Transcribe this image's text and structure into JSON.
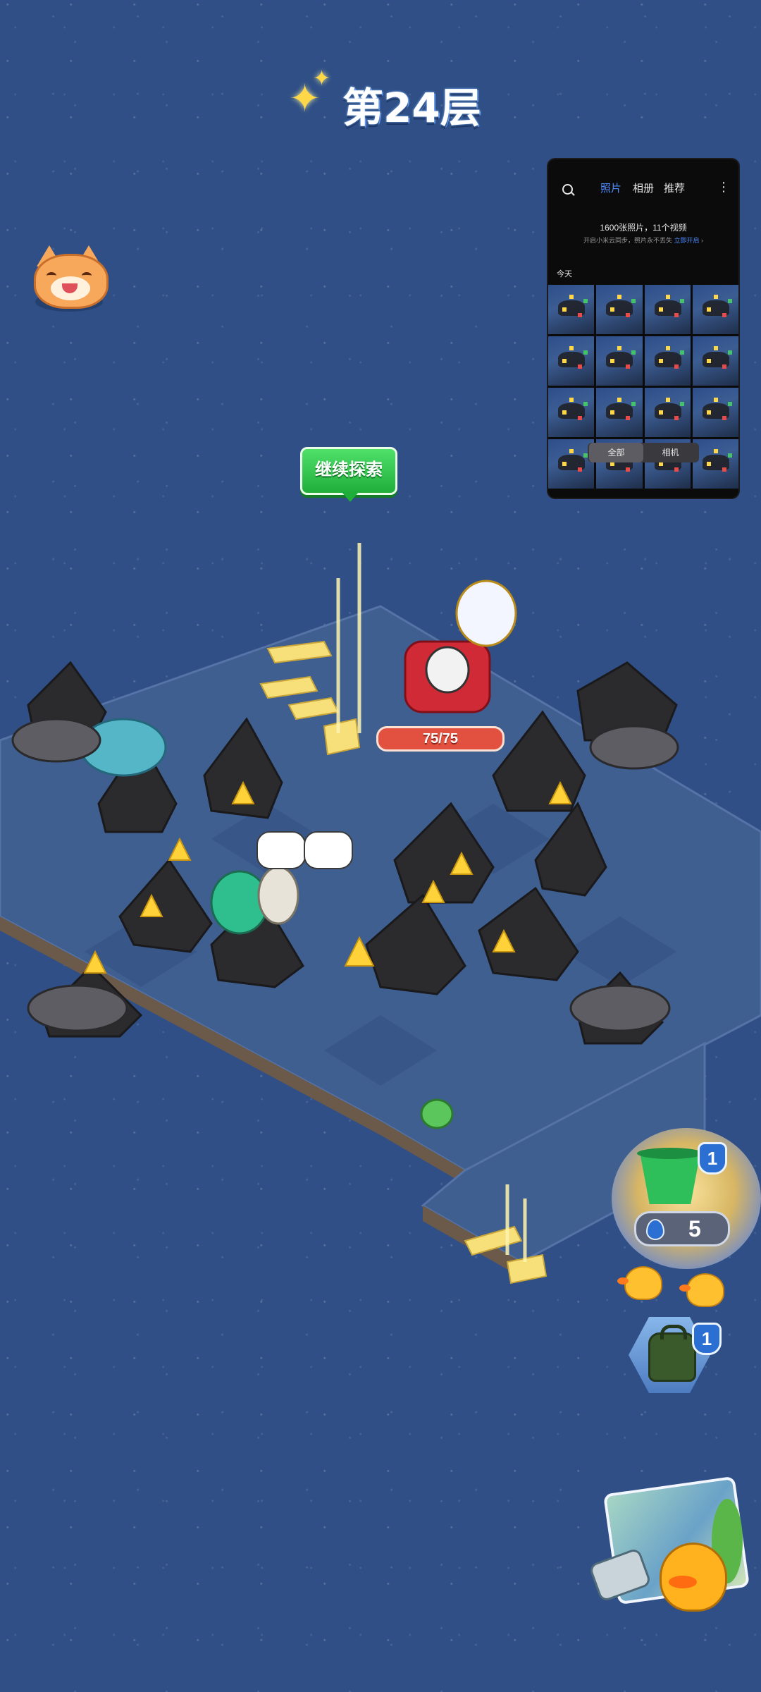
{
  "floor": {
    "title": "第24层"
  },
  "gallery": {
    "tabs": [
      "照片",
      "相册",
      "推荐"
    ],
    "active_tab": "照片",
    "summary": "1600张照片，11个视频",
    "notice": "开启小米云同步，照片永不丢失",
    "notice_link": "立即开启",
    "section": "今天",
    "segments": [
      "全部",
      "相机"
    ]
  },
  "board": {
    "continue_label": "继续探索",
    "boss_hp": "75/75"
  },
  "resources": {
    "bucket_badge": "1",
    "water_count": "5",
    "bag_badge": "1"
  },
  "colors": {
    "background": "#2f4f86",
    "tile": "#3f5f90",
    "button_green": "#2ec24a",
    "hp_red": "#e2503f"
  },
  "icons": [
    "sparkle-icon",
    "cat-avatar-icon",
    "search-icon",
    "more-icon",
    "bucket-icon",
    "water-drop-icon",
    "backpack-icon",
    "map-icon"
  ]
}
